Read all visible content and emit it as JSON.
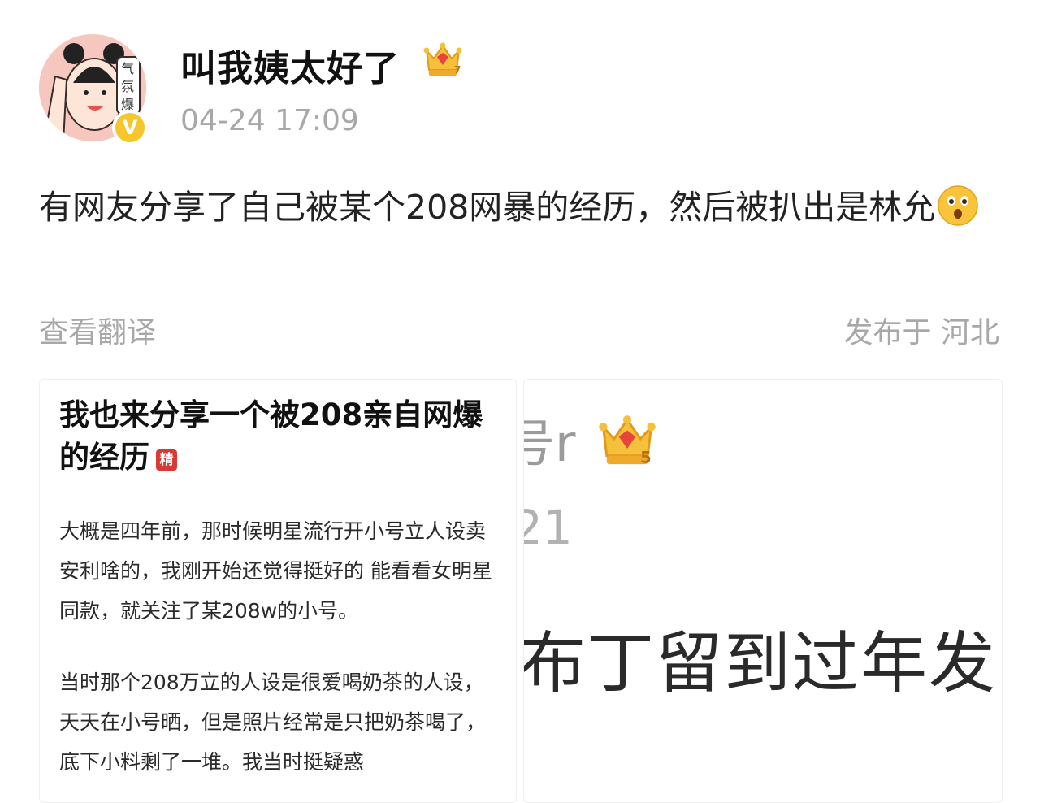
{
  "post": {
    "username": "叫我姨太好了",
    "avatar_text": "气氛爆",
    "verified_mark": "V",
    "member_level": "7",
    "timestamp": "04-24 17:09",
    "text": "有网友分享了自己被某个208网暴的经历，然后被扒出是林允",
    "emoji": "surprised-face-emoji",
    "translate_label": "查看翻译",
    "location_label": "发布于 河北"
  },
  "images": [
    {
      "title": "我也来分享一个被208亲自网爆的经历",
      "badge": "精",
      "paragraphs": [
        "大概是四年前，那时候明星流行开小号立人设卖安利啥的，我刚开始还觉得挺好的 能看看女明星同款，就关注了某208w的小号。",
        "当时那个208万立的人设是很爱喝奶茶的人设，天天在小号晒，但是照片经常是只把奶茶喝了，底下小料剩了一堆。我当时挺疑惑"
      ]
    },
    {
      "handle": "号r",
      "member_level": "5",
      "date": "21",
      "text": "布丁留到过年发"
    }
  ],
  "colors": {
    "muted_text": "#a8a8a8",
    "crown_gold": "#f2b632",
    "jing_red": "#d93a36",
    "verified_yellow": "#f6c62d"
  }
}
